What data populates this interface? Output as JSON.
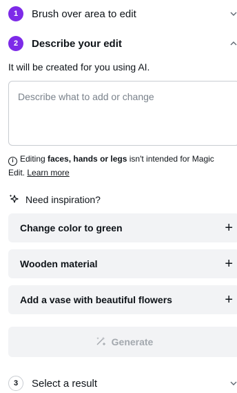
{
  "step1": {
    "number": "1",
    "title": "Brush over area to edit"
  },
  "step2": {
    "number": "2",
    "title": "Describe your edit",
    "subtitle": "It will be created for you using AI."
  },
  "prompt": {
    "placeholder": "Describe what to add or change",
    "value": ""
  },
  "notice": {
    "prefix": "Editing ",
    "bold": "faces, hands or legs",
    "suffix": " isn't intended for Magic Edit.",
    "link": "Learn more"
  },
  "inspiration": {
    "label": "Need inspiration?"
  },
  "suggestions": [
    {
      "label": "Change color to green"
    },
    {
      "label": "Wooden material"
    },
    {
      "label": "Add a vase with beautiful flowers"
    }
  ],
  "generate": {
    "label": "Generate",
    "disabled": true
  },
  "step3": {
    "number": "3",
    "title": "Select a result"
  },
  "colors": {
    "accent": "#7d2ae8",
    "panel": "#f2f3f5",
    "border": "#c8ccd1"
  },
  "icons": {
    "chevron_down": "chevron-down-icon",
    "chevron_up": "chevron-up-icon",
    "info": "info-icon",
    "sparkle": "sparkle-icon",
    "plus": "plus-icon",
    "wand": "magic-wand-icon"
  }
}
